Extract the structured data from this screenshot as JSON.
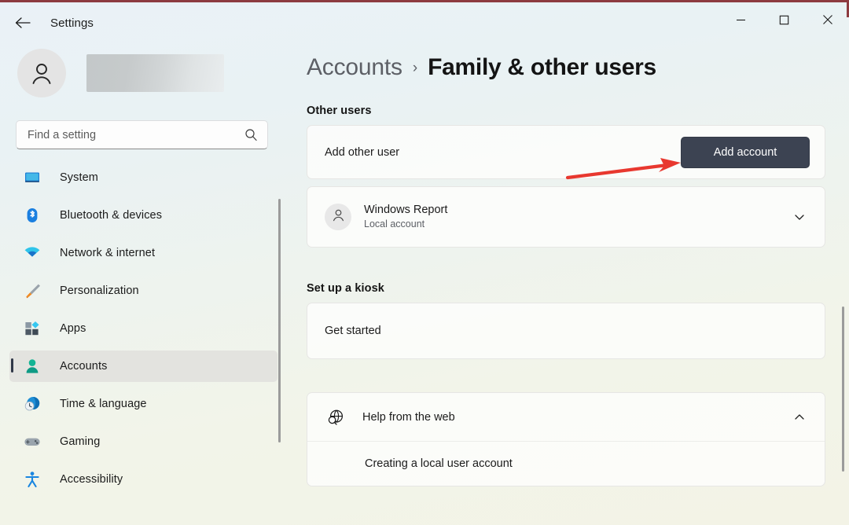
{
  "window": {
    "app_title": "Settings",
    "back_icon": "back-arrow-icon",
    "controls": {
      "minimize": "minimize-icon",
      "maximize": "maximize-icon",
      "close": "close-icon"
    }
  },
  "sidebar": {
    "account": {
      "avatar_icon": "person-avatar-icon",
      "name_redacted": true
    },
    "search": {
      "placeholder": "Find a setting",
      "value": "",
      "icon": "search-icon"
    },
    "items": [
      {
        "label": "System",
        "icon": "monitor-icon",
        "selected": false
      },
      {
        "label": "Bluetooth & devices",
        "icon": "bluetooth-icon",
        "selected": false
      },
      {
        "label": "Network & internet",
        "icon": "wifi-icon",
        "selected": false
      },
      {
        "label": "Personalization",
        "icon": "paintbrush-icon",
        "selected": false
      },
      {
        "label": "Apps",
        "icon": "apps-icon",
        "selected": false
      },
      {
        "label": "Accounts",
        "icon": "person-icon",
        "selected": true
      },
      {
        "label": "Time & language",
        "icon": "clock-globe-icon",
        "selected": false
      },
      {
        "label": "Gaming",
        "icon": "gamepad-icon",
        "selected": false
      },
      {
        "label": "Accessibility",
        "icon": "accessibility-icon",
        "selected": false
      }
    ]
  },
  "main": {
    "breadcrumb": {
      "parent": "Accounts",
      "separator": "›",
      "current": "Family & other users"
    },
    "other_users": {
      "section_title": "Other users",
      "add_other_user_label": "Add other user",
      "add_account_button": "Add account",
      "existing_user": {
        "name": "Windows Report",
        "subtitle": "Local account",
        "avatar_icon": "person-avatar-icon",
        "expander_icon": "chevron-down-icon"
      }
    },
    "kiosk": {
      "section_title": "Set up a kiosk",
      "get_started_label": "Get started"
    },
    "help": {
      "title": "Help from the web",
      "icon": "globe-search-icon",
      "expander_icon": "chevron-up-icon",
      "links": [
        {
          "label": "Creating a local user account"
        }
      ]
    }
  },
  "annotation": {
    "arrow_color": "#e8382f",
    "points_to": "Add account"
  },
  "colors": {
    "accent_button": "#3c4352",
    "selection_indicator": "#303848",
    "accounts_icon": "#13a08a",
    "frame_border": "#8d3b40"
  }
}
